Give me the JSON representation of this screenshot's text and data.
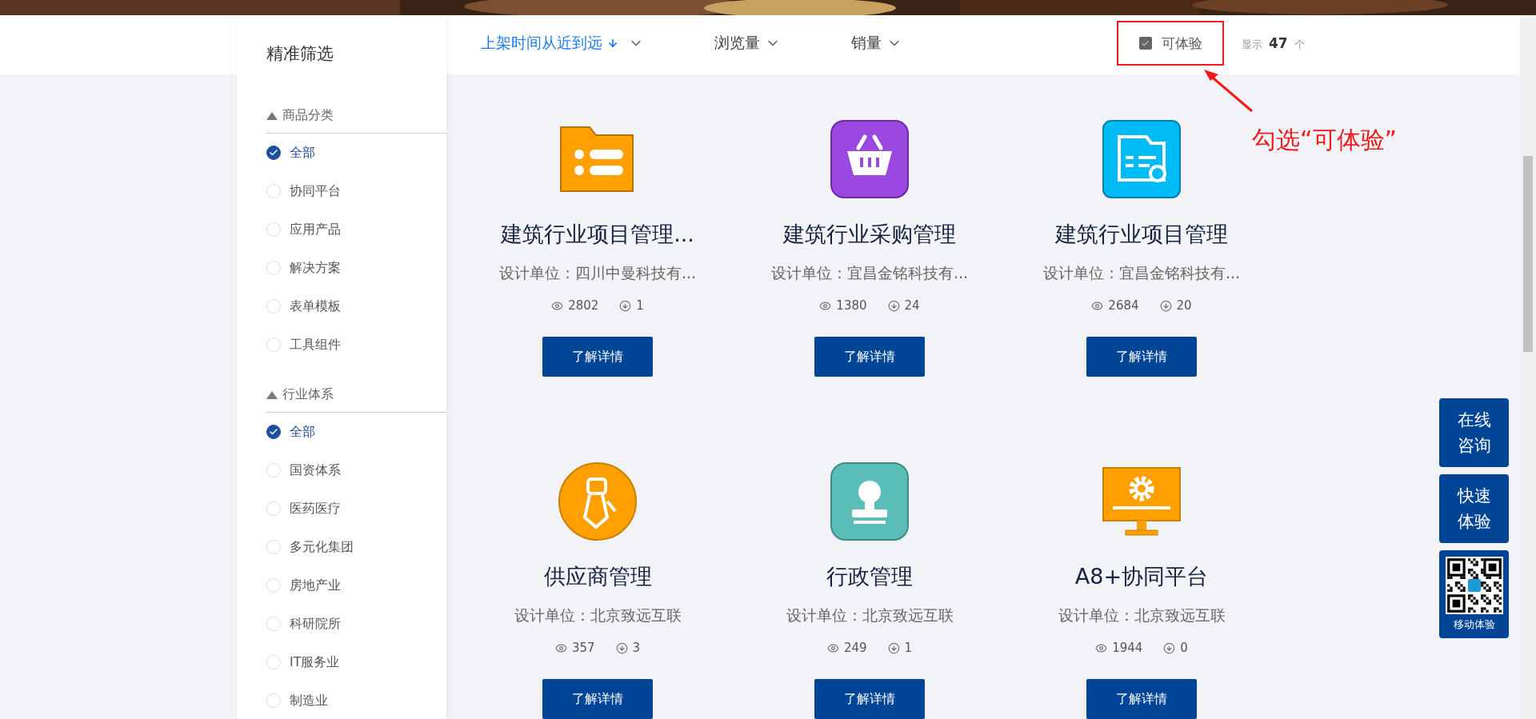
{
  "sidebar": {
    "title": "精准筛选",
    "groups": [
      {
        "title": "商品分类",
        "expanded": true,
        "options": [
          {
            "label": "全部",
            "selected": true
          },
          {
            "label": "协同平台",
            "selected": false
          },
          {
            "label": "应用产品",
            "selected": false
          },
          {
            "label": "解决方案",
            "selected": false
          },
          {
            "label": "表单模板",
            "selected": false
          },
          {
            "label": "工具组件",
            "selected": false
          }
        ]
      },
      {
        "title": "行业体系",
        "expanded": true,
        "options": [
          {
            "label": "全部",
            "selected": true
          },
          {
            "label": "国资体系",
            "selected": false
          },
          {
            "label": "医药医疗",
            "selected": false
          },
          {
            "label": "多元化集团",
            "selected": false
          },
          {
            "label": "房地产业",
            "selected": false
          },
          {
            "label": "科研院所",
            "selected": false
          },
          {
            "label": "IT服务业",
            "selected": false
          },
          {
            "label": "制造业",
            "selected": false
          }
        ]
      }
    ]
  },
  "sort_options": [
    {
      "label": "上架时间从近到远",
      "selected": true
    },
    {
      "label": "浏览量",
      "selected": false
    },
    {
      "label": "销量",
      "selected": false
    }
  ],
  "filter": {
    "label": "可体验",
    "checked": true
  },
  "count": {
    "prefix": "显示",
    "value": "47",
    "unit": "个"
  },
  "annotation": {
    "text": "勾选“可体验”"
  },
  "products": [
    {
      "kind": "folder",
      "title": "建筑行业项目管理...",
      "designer": "设计单位：四川中曼科技有...",
      "views": "2802",
      "downloads": "1",
      "button": "了解详情"
    },
    {
      "kind": "basket",
      "title": "建筑行业采购管理",
      "designer": "设计单位：宜昌金铭科技有...",
      "views": "1380",
      "downloads": "24",
      "button": "了解详情"
    },
    {
      "kind": "form",
      "title": "建筑行业项目管理",
      "designer": "设计单位：宜昌金铭科技有...",
      "views": "2684",
      "downloads": "20",
      "button": "了解详情"
    },
    {
      "kind": "tie",
      "title": "供应商管理",
      "designer": "设计单位：北京致远互联",
      "views": "357",
      "downloads": "3",
      "button": "了解详情"
    },
    {
      "kind": "stamp",
      "title": "行政管理",
      "designer": "设计单位：北京致远互联",
      "views": "249",
      "downloads": "1",
      "button": "了解详情"
    },
    {
      "kind": "monitor",
      "title": "A8+协同平台",
      "designer": "设计单位：北京致远互联",
      "views": "1944",
      "downloads": "0",
      "button": "了解详情"
    }
  ],
  "float_buttons": [
    {
      "kind": "text",
      "lines": [
        "在线",
        "咨询"
      ]
    },
    {
      "kind": "text",
      "lines": [
        "快速",
        "体验"
      ]
    },
    {
      "kind": "qr",
      "lines": [
        "移动体验"
      ]
    }
  ]
}
